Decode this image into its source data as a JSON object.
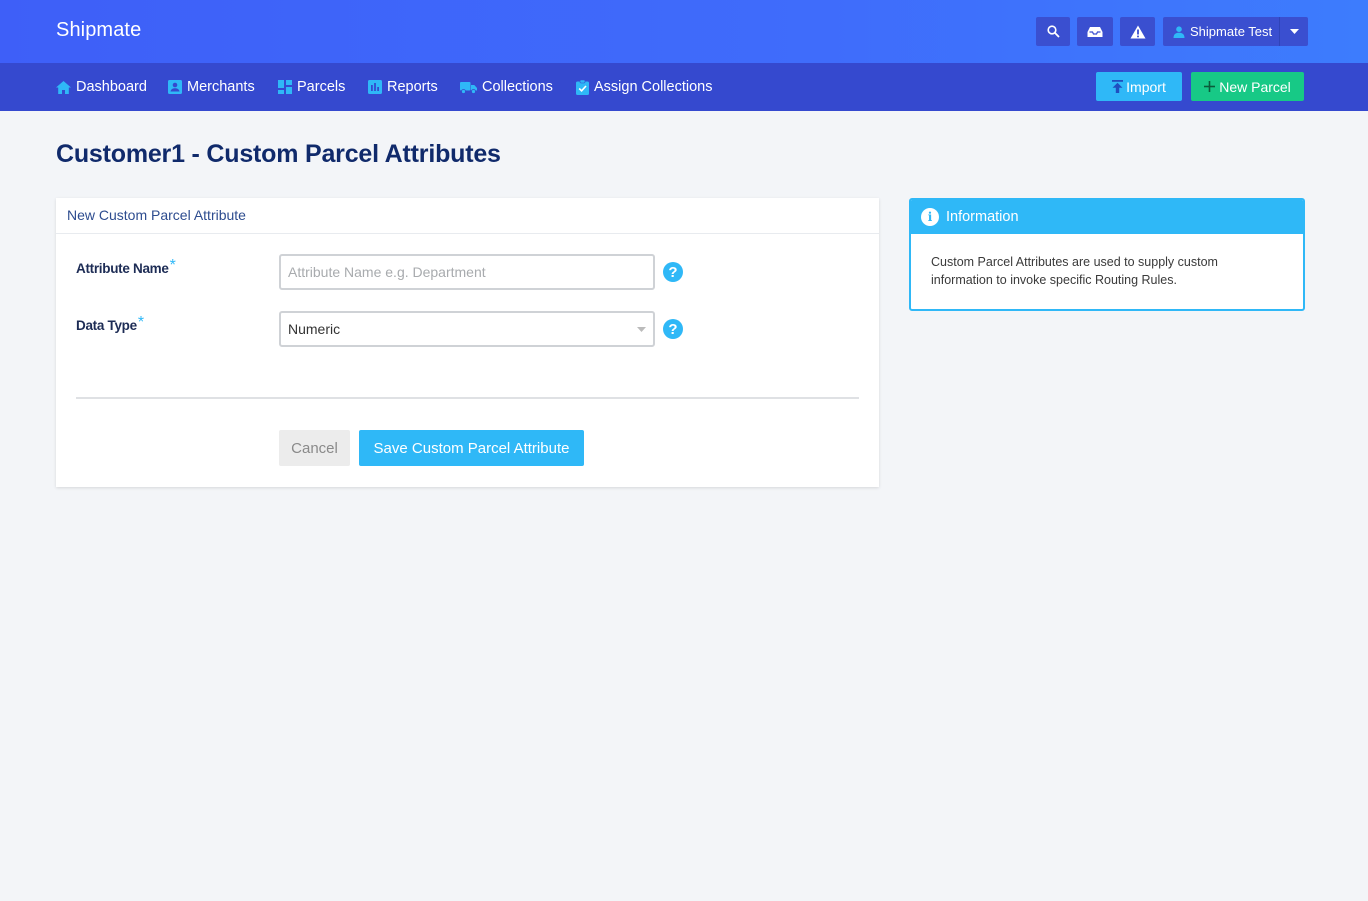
{
  "header": {
    "brand": "Shipmate",
    "icons": [
      "search-icon",
      "inbox-icon",
      "alert-icon"
    ],
    "user_name": "Shipmate Test"
  },
  "nav": {
    "items": [
      {
        "label": "Dashboard",
        "icon": "home-icon"
      },
      {
        "label": "Merchants",
        "icon": "merchant-icon"
      },
      {
        "label": "Parcels",
        "icon": "parcels-icon"
      },
      {
        "label": "Reports",
        "icon": "reports-icon"
      },
      {
        "label": "Collections",
        "icon": "truck-icon"
      },
      {
        "label": "Assign Collections",
        "icon": "clipboard-check-icon"
      }
    ],
    "import_label": "Import",
    "new_parcel_label": "New Parcel"
  },
  "page": {
    "title": "Customer1 - Custom Parcel Attributes"
  },
  "form": {
    "header": "New Custom Parcel Attribute",
    "attribute_name": {
      "label": "Attribute Name",
      "required_mark": "*",
      "value": "",
      "placeholder": "Attribute Name e.g. Department"
    },
    "data_type": {
      "label": "Data Type",
      "required_mark": "*",
      "selected": "Numeric"
    },
    "help_glyph": "?",
    "cancel_label": "Cancel",
    "save_label": "Save Custom Parcel Attribute"
  },
  "info": {
    "title": "Information",
    "icon_glyph": "i",
    "body": "Custom Parcel Attributes are used to supply custom information to invoke specific Routing Rules."
  },
  "colors": {
    "accent": "#2fb8f7",
    "success": "#17c986",
    "nav_bg": "#3549cf",
    "title": "#102a6b"
  }
}
